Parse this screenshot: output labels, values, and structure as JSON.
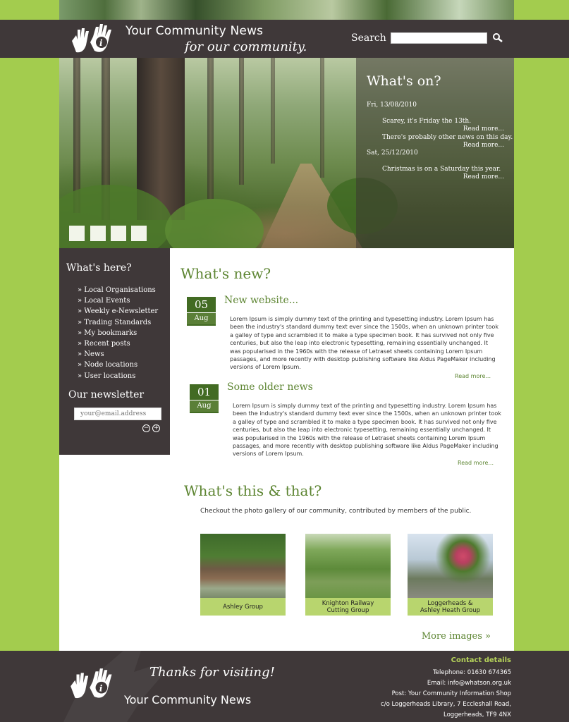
{
  "header": {
    "site_title": "Your Community News",
    "tagline": "for our community.",
    "search_label": "Search",
    "search_value": ""
  },
  "whats_on": {
    "title": "What's on?",
    "events": [
      {
        "date": "Fri, 13/08/2010",
        "text": "Scarey, it's Friday the 13th.",
        "more": "Read more..."
      },
      {
        "date": "",
        "text": "There's probably other news on this day.",
        "more": "Read more..."
      },
      {
        "date": "Sat, 25/12/2010",
        "text": "Christmas is on a Saturday this year.",
        "more": "Read more..."
      }
    ]
  },
  "sidebar": {
    "heading": "What's here?",
    "items": [
      "» Local Organisations",
      "» Local Events",
      "» Weekly e-Newsletter",
      "» Trading Standards",
      "» My bookmarks",
      "» Recent posts",
      "» News",
      "» Node locations",
      "» User locations"
    ],
    "newsletter_heading": "Our newsletter",
    "newsletter_placeholder": "your@email.address"
  },
  "whats_new": {
    "title": "What's new?",
    "posts": [
      {
        "day": "05",
        "month": "Aug",
        "title": "New website...",
        "body": "Lorem Ipsum is simply dummy text of the printing and typesetting industry. Lorem Ipsum has been the industry's standard dummy text ever since the 1500s, when an unknown printer took a galley of type and scrambled it to make a type specimen book. It has survived not only five centuries, but also the leap into electronic typesetting, remaining essentially unchanged. It was popularised in the 1960s with the release of Letraset sheets containing Lorem Ipsum passages, and more recently with desktop publishing software like Aldus PageMaker including versions of Lorem Ipsum.",
        "more": "Read more..."
      },
      {
        "day": "01",
        "month": "Aug",
        "title": "Some older news",
        "body": "Lorem Ipsum is simply dummy text of the printing and typesetting industry. Lorem Ipsum has been the industry's standard dummy text ever since the 1500s, when an unknown printer took a galley of type and scrambled it to make a type specimen book. It has survived not only five centuries, but also the leap into electronic typesetting, remaining essentially unchanged. It was popularised in the 1960s with the release of Letraset sheets containing Lorem Ipsum passages, and more recently with desktop publishing software like Aldus PageMaker including versions of Lorem Ipsum.",
        "more": "Read more..."
      }
    ]
  },
  "gallery": {
    "title": "What's this & that?",
    "intro": "Checkout the photo gallery of our community, contributed by members of the public.",
    "items": [
      {
        "caption": "Ashley Group"
      },
      {
        "caption": "Knighton Railway\nCutting Group"
      },
      {
        "caption": "Loggerheads &\nAshley Heath Group"
      }
    ],
    "more": "More images »"
  },
  "footer": {
    "thanks": "Thanks for visiting!",
    "site_name": "Your Community News",
    "contact_heading": "Contact details",
    "lines": [
      "Telephone: 01630 674365",
      "Email: info@whatson.org.uk",
      "Post: Your Community Information Shop",
      "c/o Loggerheads Library, 7 Eccleshall Road,",
      "Loggerheads, TF9 4NX"
    ]
  },
  "colors": {
    "page_bg": "#a3cc4e",
    "dark_bar": "#3f3839",
    "accent_green": "#5d8532",
    "date_box": "#426b23",
    "caption_bg": "#b8d56e"
  }
}
